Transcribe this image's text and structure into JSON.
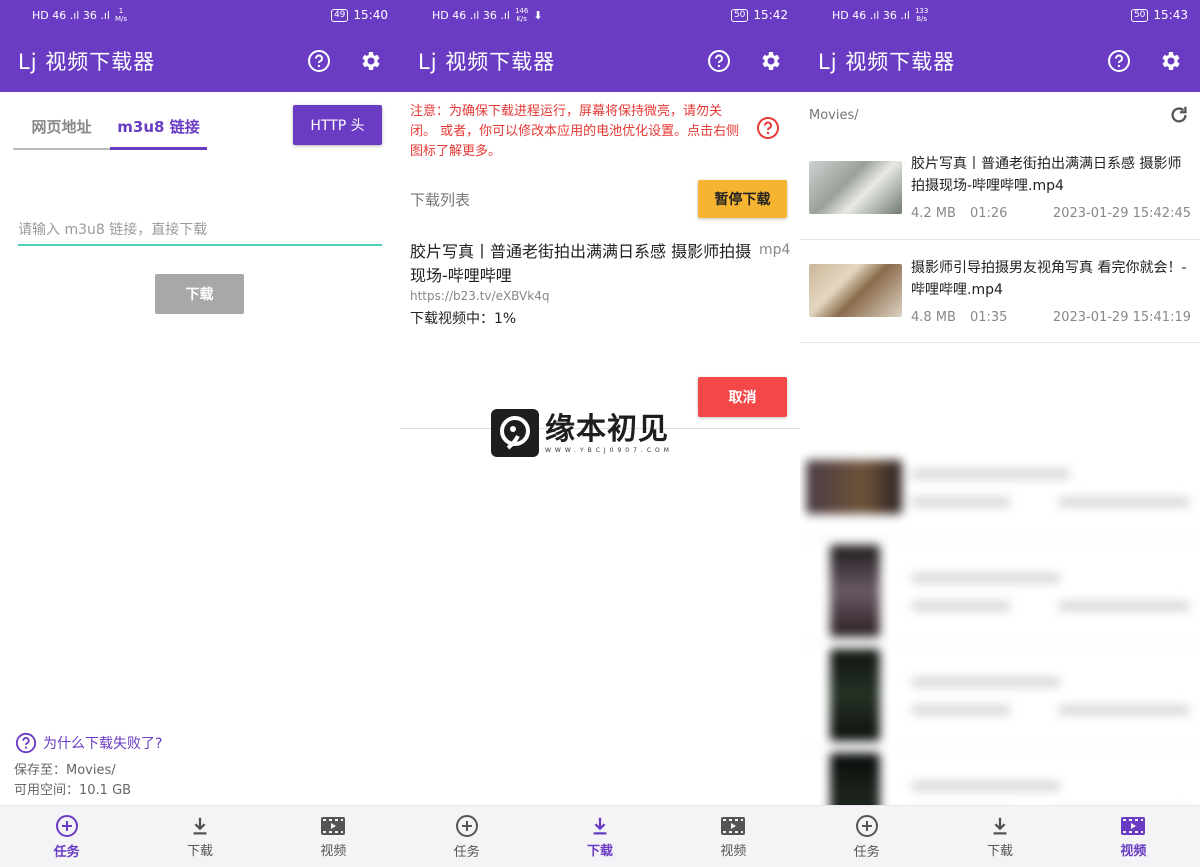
{
  "status_bars": [
    {
      "left": "HD 46 .ıl 36 .ıl",
      "speed_top": "1",
      "speed_bottom": "M/s",
      "battery": "49",
      "time": "15:40"
    },
    {
      "left": "HD 46 .ıl 36 .ıl",
      "speed_top": "146",
      "speed_bottom": "K/s",
      "battery": "50",
      "time": "15:42"
    },
    {
      "left": "HD 46 .ıl 36 .ıl",
      "speed_top": "133",
      "speed_bottom": "B/s",
      "battery": "50",
      "time": "15:43"
    }
  ],
  "app": {
    "title": "Lj 视频下载器",
    "help_icon": "help-circle-icon",
    "settings_icon": "gear-icon",
    "bar_color": "#6a3cc4"
  },
  "nav": {
    "task": "任务",
    "download": "下载",
    "video": "视频"
  },
  "screen1": {
    "tab_web": "网页地址",
    "tab_m3u8": "m3u8 链接",
    "http_button": "HTTP 头",
    "input_placeholder": "请输入 m3u8 链接，直接下载",
    "download_button": "下载",
    "fail_link": "为什么下载失败了?",
    "save_to": "保存至：Movies/",
    "free_space": "可用空间：10.1 GB"
  },
  "screen2": {
    "warning": "注意：为确保下载进程运行，屏幕将保持微亮，请勿关闭。 或者，你可以修改本应用的电池优化设置。点击右侧图标了解更多。",
    "list_header": "下载列表",
    "pause_button": "暂停下载",
    "task": {
      "title": "胶片写真丨普通老街拍出满满日系感 摄影师拍摄现场-哔哩哔哩",
      "ext": "mp4",
      "url": "https://b23.tv/eXBVk4q",
      "status": "下载视频中：1%",
      "progress_percent": 1
    },
    "cancel_button": "取消",
    "watermark_main": "缘本初见",
    "watermark_sub": "WWW.YBCJ0907.COM"
  },
  "screen3": {
    "path": "Movies/",
    "videos": [
      {
        "title": "胶片写真丨普通老街拍出满满日系感 摄影师拍摄现场-哔哩哔哩.mp4",
        "size": "4.2 MB",
        "duration": "01:26",
        "date": "2023-01-29 15:42:45"
      },
      {
        "title": "摄影师引导拍摄男友视角写真 看完你就会！-哔哩哔哩.mp4",
        "size": "4.8 MB",
        "duration": "01:35",
        "date": "2023-01-29 15:41:19"
      }
    ]
  }
}
